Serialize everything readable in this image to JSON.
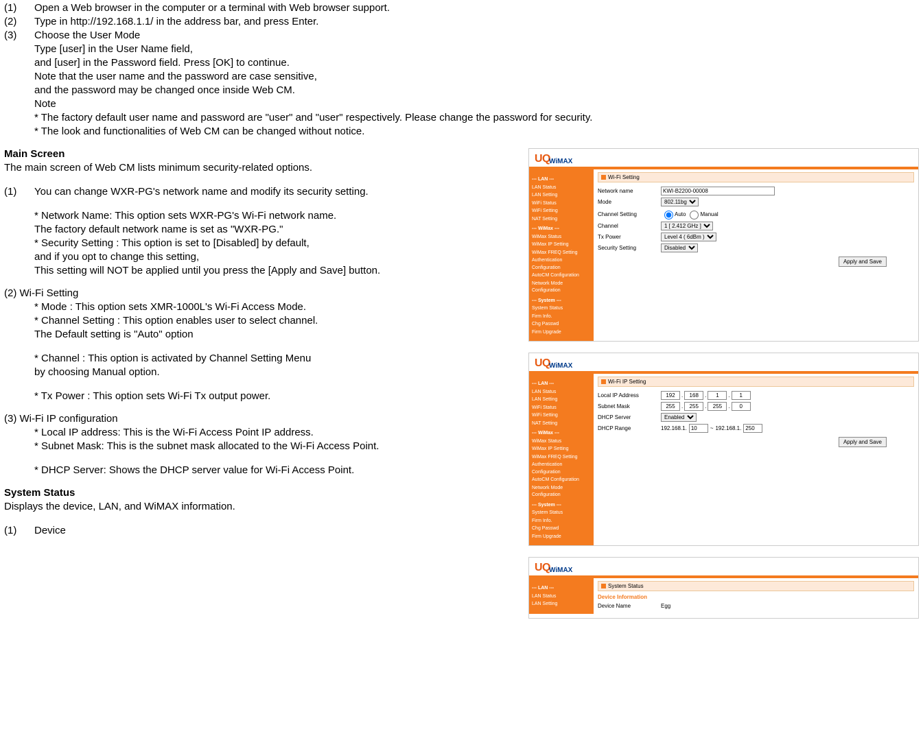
{
  "steps": {
    "s1_num": "(1)",
    "s1_text": "Open a Web browser in the computer or a terminal with Web browser support.",
    "s2_num": "(2)",
    "s2_text": "Type in http://192.168.1.1/ in the address bar, and press Enter.",
    "s3_num": "(3)",
    "s3_text": "Choose the User Mode",
    "s3_p1": "Type [user] in the User Name field,",
    "s3_p2": "and [user] in the Password field. Press [OK] to continue.",
    "s3_p3": "Note that the user name and the password are case sensitive,",
    "s3_p4": "and the password may be changed once inside Web CM.",
    "s3_p5": "Note",
    "s3_p6": "* The factory default user name and password are \"user\" and \"user\" respectively. Please change the password for security.",
    "s3_p7": "* The look and functionalities of Web CM can be changed without notice."
  },
  "main": {
    "h": "Main Screen",
    "p1": "The main screen of Web CM lists minimum security-related options.",
    "n1_num": "(1)",
    "n1_text": "You can change WXR-PG's network name and modify its security setting.",
    "n1_b1": "* Network Name: This option sets WXR-PG's Wi-Fi network name.",
    "n1_b2": "The factory default network name is set as \"WXR-PG.\"",
    "n1_b3": "* Security Setting : This option is set to [Disabled] by default,",
    "n1_b4": "and if you opt to change this setting,",
    "n1_b5": "This setting will NOT be applied until you press the [Apply and Save] button."
  },
  "wifi": {
    "h": "(2) Wi-Fi Setting",
    "p1": "* Mode : This option sets XMR-1000L's Wi-Fi Access Mode.",
    "p2": "* Channel Setting : This option enables user to select channel.",
    "p3": "   The Default setting is \"Auto\" option",
    "p4": "* Channel : This option is activated by Channel Setting Menu",
    "p5": "    by choosing Manual option.",
    "p6": "* Tx Power  : This option sets Wi-Fi Tx output power."
  },
  "ip": {
    "h": "(3) Wi-Fi IP configuration",
    "p1": "* Local IP address: This is the Wi-Fi Access Point IP address.",
    "p2": "* Subnet Mask: This is the subnet mask allocated to the Wi-Fi Access Point.",
    "p3": "* DHCP Server: Shows the DHCP server value for Wi-Fi Access Point."
  },
  "sys": {
    "h": "System Status",
    "p1": "Displays the device, LAN, and WiMAX information.",
    "d_num": "(1)",
    "d_text": "Device"
  },
  "logo": {
    "uq": "UQ",
    "wimax": "WiMAX"
  },
  "sidebar": {
    "lan_h": "--- LAN ---",
    "lan_status": "LAN Status",
    "lan_setting": "LAN Setting",
    "wifi_status": "WiFi Status",
    "wifi_setting": "WiFi Setting",
    "nat_setting": "NAT Setting",
    "wimax_h": "--- WiMax ---",
    "wimax_status": "WiMax Status",
    "wimax_ip": "WiMax IP Setting",
    "wimax_freq": "WiMax FREQ Setting",
    "auth": "Authentication Configuration",
    "autocm": "AutoCM Configuration",
    "netmode": "Network Mode Configuration",
    "sys_h": "--- System ---",
    "sys_status": "System Status",
    "firm_info": "Firm Info.",
    "chg_passwd": "Chg Passwd",
    "firm_upgrade": "Firm Upgrade"
  },
  "shot1": {
    "title": "Wi-Fi Setting",
    "netname_lbl": "Network name",
    "netname_val": "KWI-B2200-00008",
    "mode_lbl": "Mode",
    "mode_val": "802.11bg",
    "chset_lbl": "Channel Setting",
    "chset_auto": "Auto",
    "chset_manual": "Manual",
    "ch_lbl": "Channel",
    "ch_val": "1 [ 2.412 GHz ]",
    "tx_lbl": "Tx Power",
    "tx_val": "Level 4 ( 6dBm )",
    "sec_lbl": "Security Setting",
    "sec_val": "Disabled",
    "btn": "Apply and Save"
  },
  "shot2": {
    "title": "Wi-Fi IP Setting",
    "ip_lbl": "Local IP Address",
    "ip_vals": [
      "192",
      "168",
      "1",
      "1"
    ],
    "mask_lbl": "Subnet Mask",
    "mask_vals": [
      "255",
      "255",
      "255",
      "0"
    ],
    "dhcp_lbl": "DHCP Server",
    "dhcp_val": "Enabled",
    "range_lbl": "DHCP Range",
    "range_prefix1": "192.168.1.",
    "range_v1": "10",
    "range_tilde": "~",
    "range_prefix2": "192.168.1.",
    "range_v2": "250",
    "btn": "Apply and Save"
  },
  "shot3": {
    "title": "System Status",
    "dev_h": "Device Information",
    "devname_lbl": "Device Name",
    "devname_val": "Egg"
  }
}
